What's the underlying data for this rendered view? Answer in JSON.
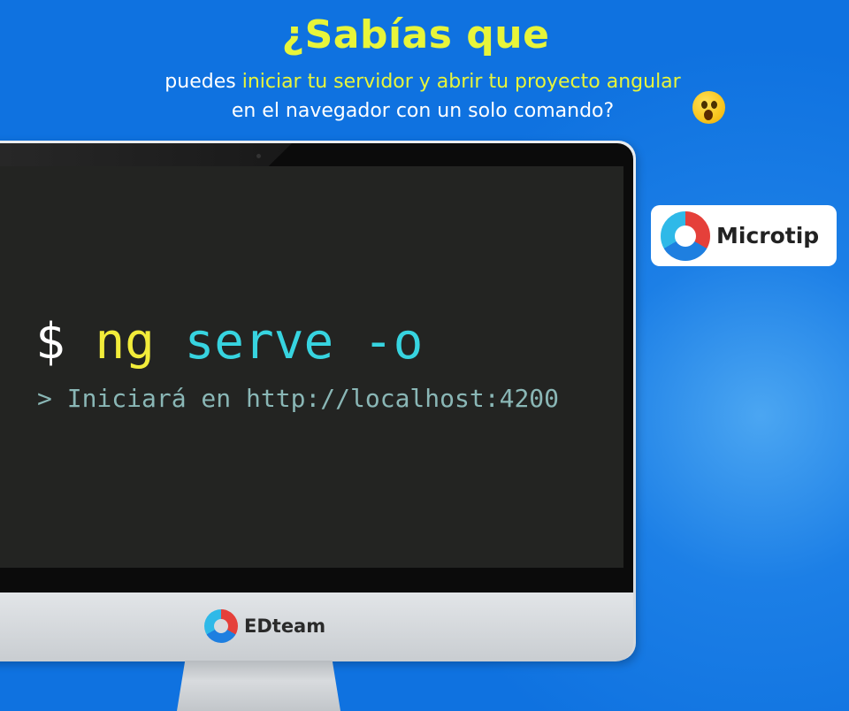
{
  "header": {
    "title": "¿Sabías que",
    "line1_prefix": "puedes ",
    "line1_highlight": "iniciar tu servidor y abrir tu proyecto angular",
    "line2": "en el navegador con un solo comando?",
    "emoji_icon": "astonished-face-icon"
  },
  "terminal": {
    "prompt": "$",
    "command_name": "ng",
    "command_args": "serve -o",
    "output": "> Iniciará en http://localhost:4200"
  },
  "monitor": {
    "brand_label": "EDteam",
    "brand_icon": "edteam-logo-icon"
  },
  "badge": {
    "label": "Microtip",
    "icon": "edteam-logo-icon"
  },
  "colors": {
    "background": "#0f72e0",
    "highlight": "#e8f53a",
    "command_name": "#f2ec3a",
    "command_args": "#37d4e0",
    "output_text": "#8ab7b6",
    "screen": "#232422"
  }
}
